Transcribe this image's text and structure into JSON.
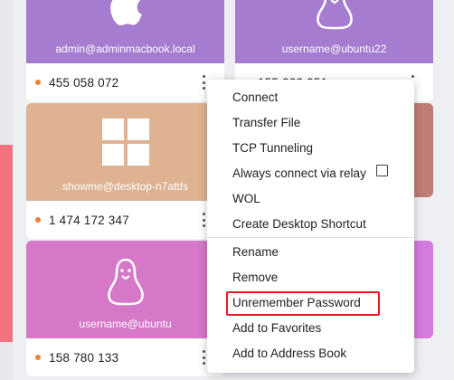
{
  "colors": {
    "mac_card": "#a67cd0",
    "ubuntu22_card": "#a67cd0",
    "windows_card": "#dfb291",
    "ubuntu_card": "#d678c8",
    "right_mid_card": "#c07c74",
    "right_bottom_card": "#d57be0",
    "online_dot": "#f07f2e",
    "highlight": "#e11d1d"
  },
  "cards": {
    "mac": {
      "username": "admin@adminmacbook.local",
      "peer_id": "455 058 072",
      "icon": "apple-icon"
    },
    "ubuntu22": {
      "username": "username@ubuntu22",
      "peer_id": "155 323 351",
      "icon": "linux-tux-icon"
    },
    "windows": {
      "username": "showme@desktop-n7attfs",
      "peer_id": "1 474 172 347",
      "icon": "windows-icon"
    },
    "ubuntu": {
      "username": "username@ubuntu",
      "peer_id": "158 780 133",
      "icon": "linux-tux-icon"
    }
  },
  "menu": {
    "connect": "Connect",
    "transfer_file": "Transfer File",
    "tcp_tunneling": "TCP Tunneling",
    "always_relay": "Always connect via relay",
    "wol": "WOL",
    "create_shortcut": "Create Desktop Shortcut",
    "rename": "Rename",
    "remove": "Remove",
    "unremember_password": "Unremember Password",
    "add_favorites": "Add to Favorites",
    "add_address_book": "Add to Address Book"
  }
}
